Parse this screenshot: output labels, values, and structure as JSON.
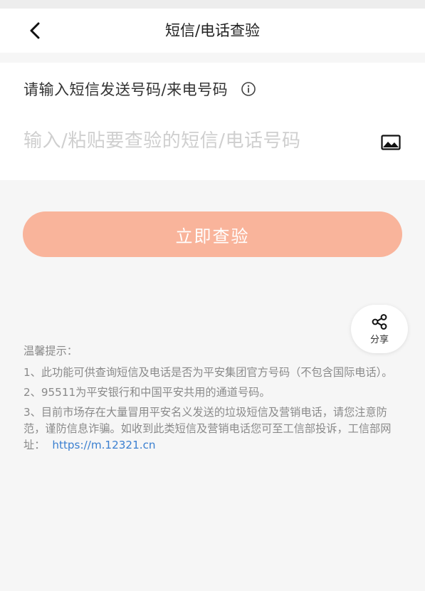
{
  "header": {
    "title": "短信/电话查验",
    "back_icon": "chevron-left-icon"
  },
  "form": {
    "label": "请输入短信发送号码/来电号码",
    "info_icon": "info-circle-icon",
    "input_value": "",
    "input_placeholder": "输入/粘贴要查验的短信/电话号码",
    "image_icon": "image-icon"
  },
  "actions": {
    "check_label": "立即查验"
  },
  "share": {
    "label": "分享",
    "icon": "share-icon"
  },
  "tips": {
    "title": "温馨提示：",
    "items": [
      "1、此功能可供查询短信及电话是否为平安集团官方号码（不包含国际电话）。",
      "2、95511为平安银行和中国平安共用的通道号码。",
      "3、目前市场存在大量冒用平安名义发送的垃圾短信及营销电话，请您注意防范，谨防信息诈骗。如收到此类短信及营销电话您可至工信部投诉，工信部网址："
    ],
    "link_text": "https://m.12321.cn"
  },
  "colors": {
    "accent": "#f9b49b",
    "link": "#3a7fd0",
    "page_bg": "#f6f6f6",
    "tip_text": "#8a8a8a"
  }
}
